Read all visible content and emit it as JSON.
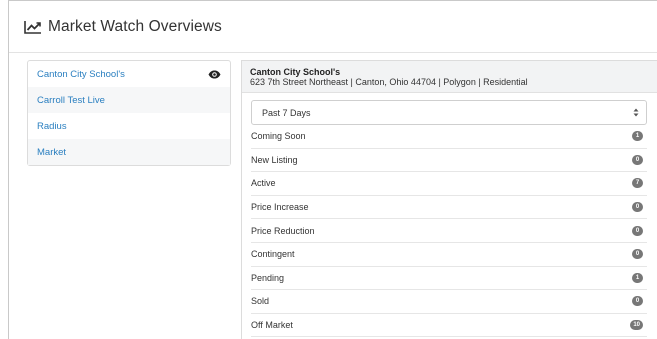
{
  "header": {
    "title": "Market Watch Overviews",
    "icon": "chart-line-icon"
  },
  "sidebar": {
    "items": [
      {
        "label": "Canton City School's",
        "icon": "eye-icon"
      },
      {
        "label": "Carroll Test Live"
      },
      {
        "label": "Radius"
      },
      {
        "label": "Market"
      }
    ]
  },
  "panel": {
    "name": "Canton City School's",
    "address": "623 7th Street Northeast | Canton, Ohio 44704 | Polygon | Residential",
    "period": {
      "selected": "Past 7 Days"
    },
    "rows": [
      {
        "label": "Coming Soon",
        "count": "1"
      },
      {
        "label": "New Listing",
        "count": "0"
      },
      {
        "label": "Active",
        "count": "7"
      },
      {
        "label": "Price Increase",
        "count": "0"
      },
      {
        "label": "Price Reduction",
        "count": "0"
      },
      {
        "label": "Contingent",
        "count": "0"
      },
      {
        "label": "Pending",
        "count": "1"
      },
      {
        "label": "Sold",
        "count": "0"
      },
      {
        "label": "Off Market",
        "count": "10"
      }
    ]
  },
  "colors": {
    "link": "#2a7fc0",
    "badge": "#777777"
  }
}
